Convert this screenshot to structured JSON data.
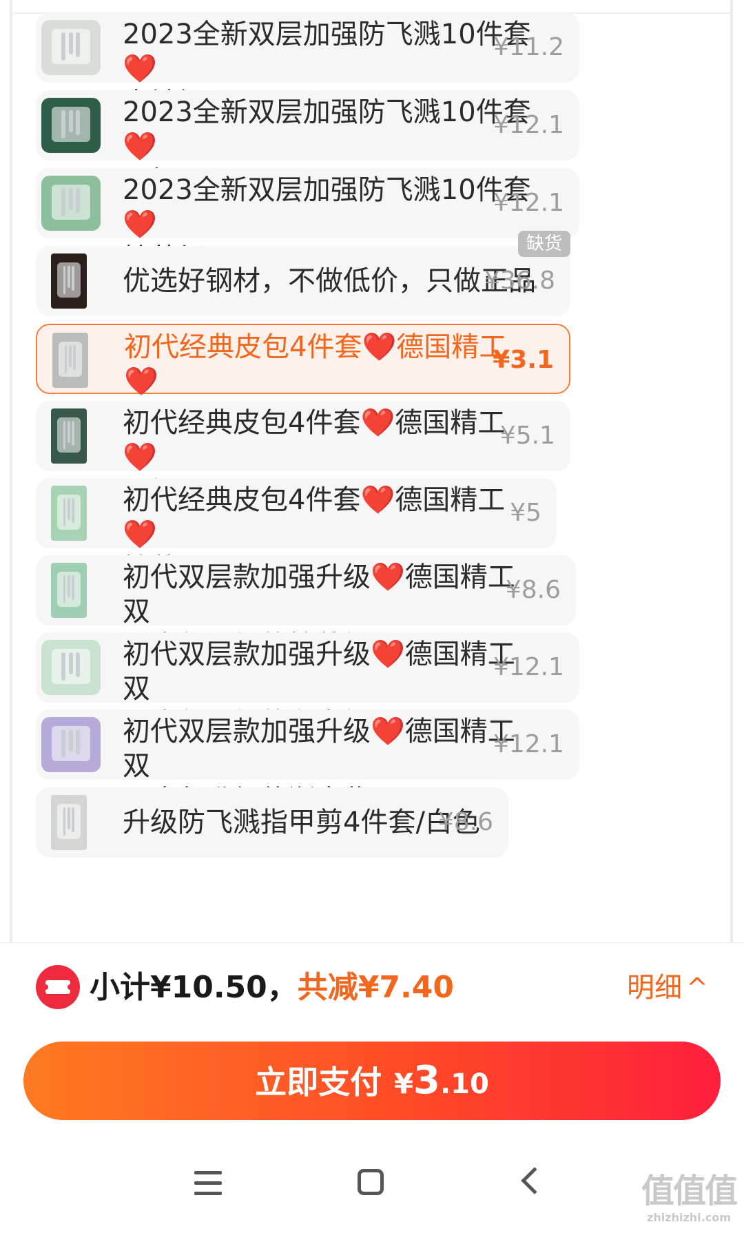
{
  "sku_list": {
    "items": [
      {
        "name_line1": "2023全新双层加强防飞溅10件套",
        "heart1": "❤️",
        "name_mid": "",
        "heart2": "",
        "name_line2": "电镀银.",
        "price": "¥11.2",
        "state": "normal",
        "thumb_color": "#d9ddd8"
      },
      {
        "name_line1": "2023全新双层加强防飞溅10件套",
        "heart1": "❤️",
        "name_mid": "",
        "heart2": "",
        "name_line2": "墨绿.",
        "price": "¥12.1",
        "state": "normal",
        "thumb_color": "#2f5e48"
      },
      {
        "name_line1": "2023全新双层加强防飞溅10件套",
        "heart1": "❤️",
        "name_mid": "",
        "heart2": "",
        "name_line2": "抹茶绿.",
        "price": "¥12.1",
        "state": "normal",
        "thumb_color": "#8ebf9c"
      },
      {
        "name_line1": "优选好钢材，不做低价，只做正品",
        "heart1": "",
        "name_mid": "",
        "heart2": "",
        "name_line2": "",
        "price": "¥36.8",
        "state": "out_of_stock",
        "badge": "缺货",
        "thumb_color": "#2a1f1a"
      },
      {
        "name_line1": "初代经典皮包4件套",
        "heart1": "❤️",
        "name_mid": "德国精工",
        "heart2": "❤️",
        "name_line2": "白色.",
        "price": "¥3.1",
        "state": "selected",
        "thumb_color": "#b8bcba"
      },
      {
        "name_line1": "初代经典皮包4件套",
        "heart1": "❤️",
        "name_mid": "德国精工",
        "heart2": "❤️",
        "name_line2": "墨绿.",
        "price": "¥5.1",
        "state": "normal",
        "thumb_color": "#37594a"
      },
      {
        "name_line1": "初代经典皮包4件套",
        "heart1": "❤️",
        "name_mid": "德国精工",
        "heart2": "❤️",
        "name_line2": "抹茶.",
        "price": "¥5",
        "state": "normal",
        "thumb_color": "#a7d2b3"
      },
      {
        "name_line1": "初代双层款加强升级",
        "heart1": "❤️",
        "name_mid": "德国精工双",
        "heart2": "",
        "name_line2": "层皮包升级款抹茶绿.",
        "price": "¥8.6",
        "state": "normal",
        "thumb_color": "#9fcfb2"
      },
      {
        "name_line1": "初代双层款加强升级",
        "heart1": "❤️",
        "name_mid": "德国精工双",
        "heart2": "",
        "name_line2": "层皮包升级款渐变绿",
        "price": "¥12.1",
        "state": "normal",
        "thumb_color": "#c9e2d2"
      },
      {
        "name_line1": "初代双层款加强升级",
        "heart1": "❤️",
        "name_mid": "德国精工双",
        "heart2": "",
        "name_line2": "层皮包升级款渐变紫",
        "price": "¥12.1",
        "state": "normal",
        "thumb_color": "#b7a9d8"
      },
      {
        "name_line1": "升级防飞溅指甲剪4件套/白色",
        "heart1": "",
        "name_mid": "",
        "heart2": "",
        "name_line2": "",
        "price": "¥8.6",
        "state": "partial",
        "thumb_color": "#d4d6d3"
      }
    ]
  },
  "summary": {
    "subtotal": "小计¥10.50，",
    "discount": "共减¥7.40",
    "details_label": "明细",
    "details_chevron": "^"
  },
  "pay_button": {
    "label": "立即支付",
    "currency": "¥",
    "amount_int": "3",
    "amount_dec": ".10"
  },
  "watermark": {
    "logo": "值值值",
    "site": "zhizhizhi.com"
  },
  "colors": {
    "accent": "#f2661d",
    "pay_gradient_start": "#ff7a22",
    "pay_gradient_end": "#ff1f3c",
    "coupon_icon": "#ef2a3f",
    "heart": "#e02828"
  },
  "icons": [
    "coupon-icon",
    "chevron-up-icon",
    "menu-icon",
    "home-icon",
    "back-icon",
    "heart-icon"
  ]
}
